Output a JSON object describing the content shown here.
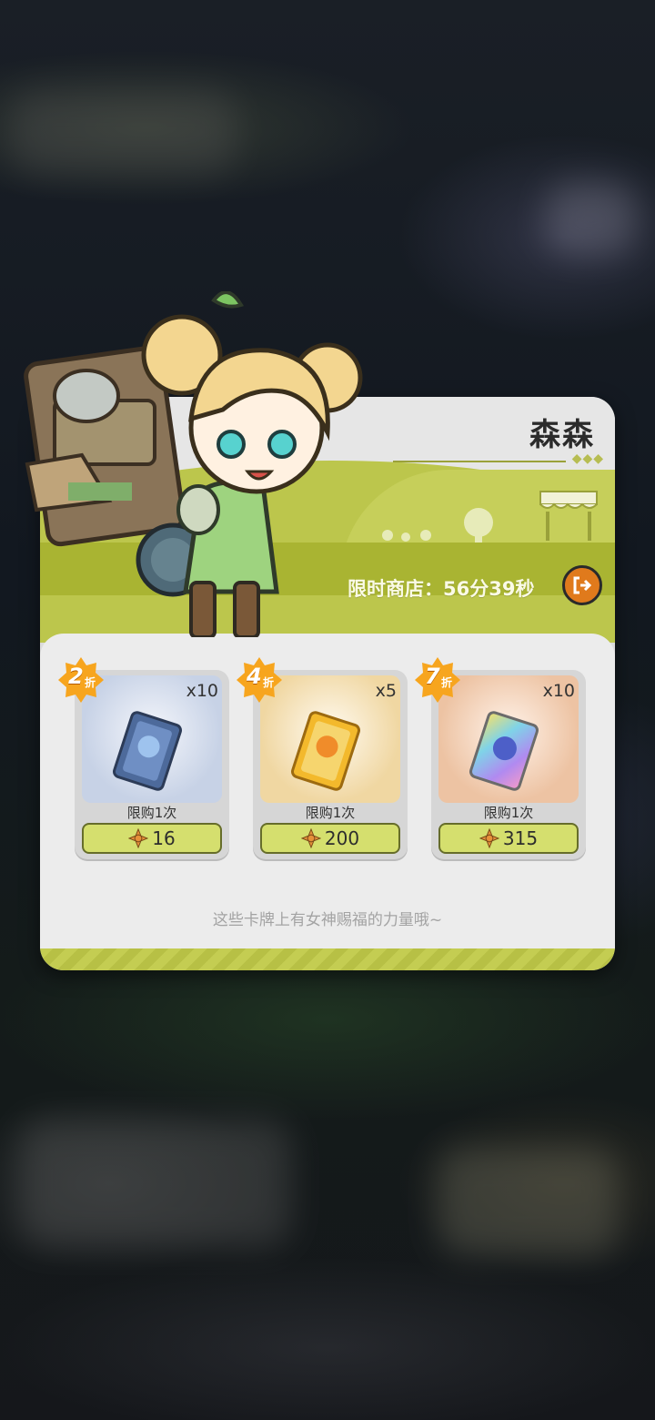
{
  "shop": {
    "npc_name": "森森",
    "timer_text": "限时商店：56分39秒",
    "flavor_text": "这些卡牌上有女神赐福的力量哦~",
    "items": [
      {
        "discount": "2",
        "discount_unit": "折",
        "quantity": "x10",
        "limit": "限购1次",
        "price": "16",
        "frame": "blue"
      },
      {
        "discount": "4",
        "discount_unit": "折",
        "quantity": "x5",
        "limit": "限购1次",
        "price": "200",
        "frame": "gold"
      },
      {
        "discount": "7",
        "discount_unit": "折",
        "quantity": "x10",
        "limit": "限购1次",
        "price": "315",
        "frame": "rainbow"
      }
    ]
  },
  "colors": {
    "panel_green": "#a9b432",
    "price_button": "#d5df6e",
    "exit_button": "#e07a1c"
  },
  "icons": {
    "exit": "exit-icon",
    "currency": "crystal-icon"
  }
}
